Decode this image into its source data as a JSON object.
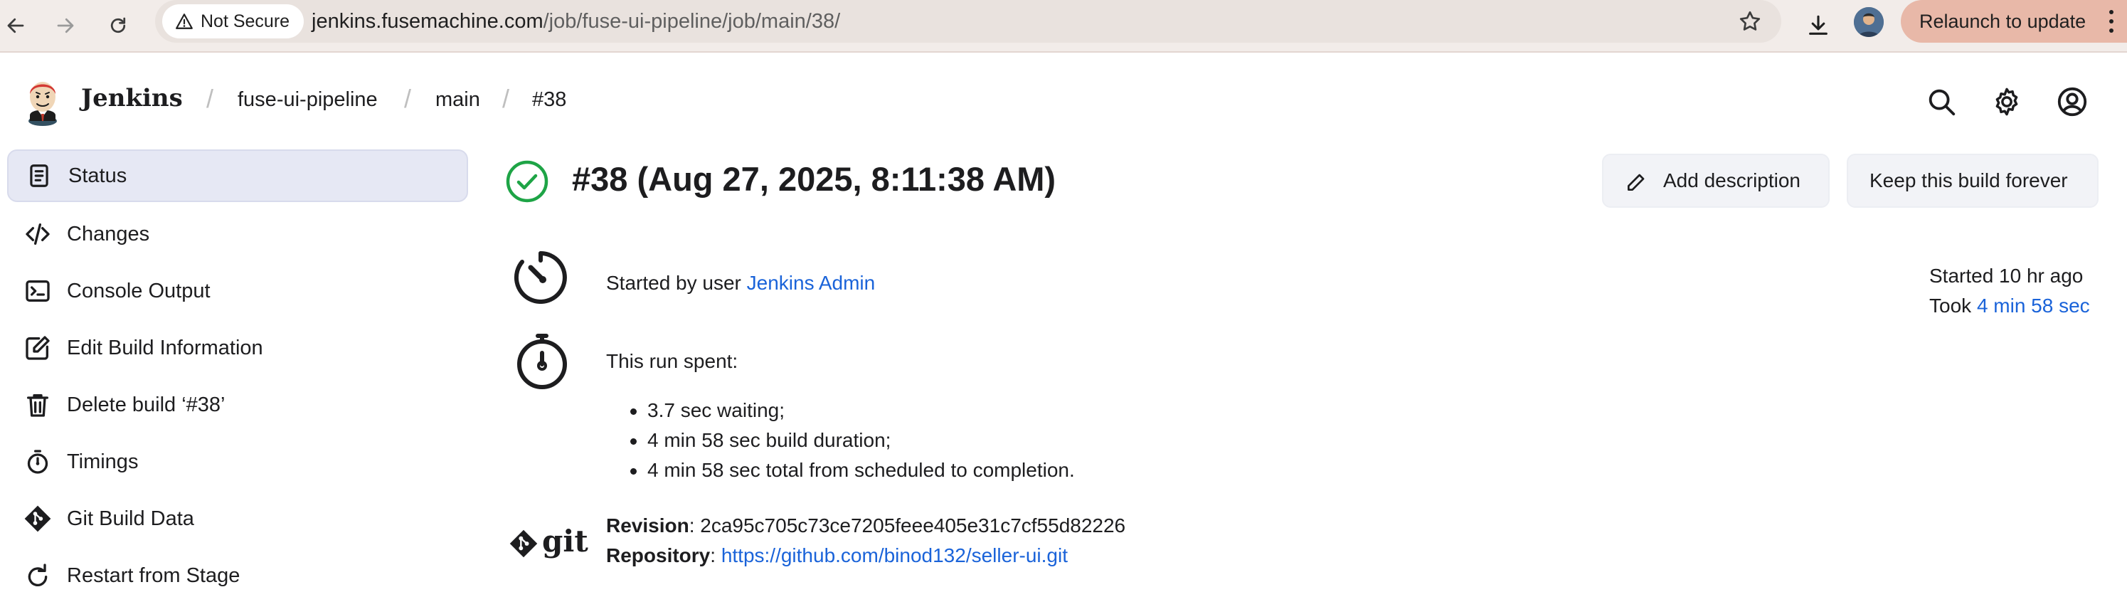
{
  "browser": {
    "security_label": "Not Secure",
    "url_host": "jenkins.fusemachine.com",
    "url_path": "/job/fuse-ui-pipeline/job/main/38/",
    "relaunch_label": "Relaunch to update"
  },
  "header": {
    "brand": "Jenkins",
    "breadcrumbs": [
      "fuse-ui-pipeline",
      "main",
      "#38"
    ]
  },
  "sidebar": {
    "items": [
      {
        "label": "Status",
        "icon": "status-icon",
        "active": true
      },
      {
        "label": "Changes",
        "icon": "code-icon"
      },
      {
        "label": "Console Output",
        "icon": "terminal-icon"
      },
      {
        "label": "Edit Build Information",
        "icon": "edit-icon"
      },
      {
        "label": "Delete build ‘#38’",
        "icon": "trash-icon"
      },
      {
        "label": "Timings",
        "icon": "stopwatch-icon"
      },
      {
        "label": "Git Build Data",
        "icon": "git-icon"
      },
      {
        "label": "Restart from Stage",
        "icon": "restart-icon"
      }
    ]
  },
  "build": {
    "title": "#38 (Aug 27, 2025, 8:11:38 AM)",
    "status_color": "#1ea446",
    "add_description_label": "Add description",
    "keep_forever_label": "Keep this build forever",
    "started_by_prefix": "Started by user ",
    "started_by_user": "Jenkins Admin",
    "started_ago": "Started 10 hr ago",
    "took_prefix": "Took ",
    "took_value": "4 min 58 sec",
    "run_spent_label": "This run spent:",
    "run_spent_items": [
      "3.7 sec waiting;",
      "4 min 58 sec build duration;",
      "4 min 58 sec total from scheduled to completion."
    ],
    "git_logo_text": "git",
    "revision_label": "Revision",
    "revision_value": ": 2ca95c705c73ce7205feee405e31c7cf55d82226",
    "repository_label": "Repository",
    "repository_sep": ": ",
    "repository_url": "https://github.com/binod132/seller-ui.git"
  },
  "colors": {
    "link": "#1a63d9",
    "active_nav_bg": "#e6e8f4",
    "relaunch_bg": "#e8b8a8"
  }
}
